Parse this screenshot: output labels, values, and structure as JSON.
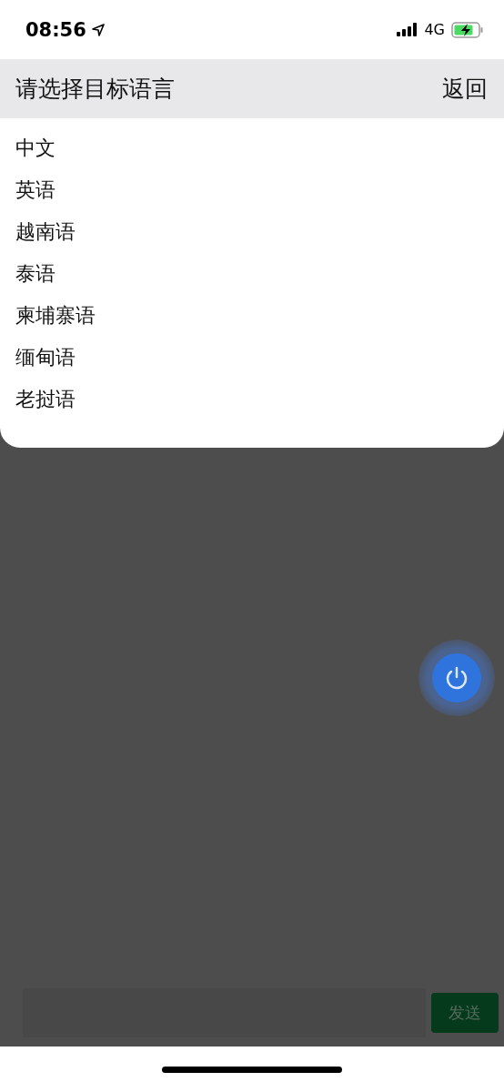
{
  "status_bar": {
    "time": "08:56",
    "network": "4G"
  },
  "header": {
    "title": "请选择目标语言",
    "back": "返回"
  },
  "languages": [
    "中文",
    "英语",
    "越南语",
    "泰语",
    "柬埔寨语",
    "缅甸语",
    "老挝语"
  ],
  "input_bar": {
    "send": "发送"
  }
}
